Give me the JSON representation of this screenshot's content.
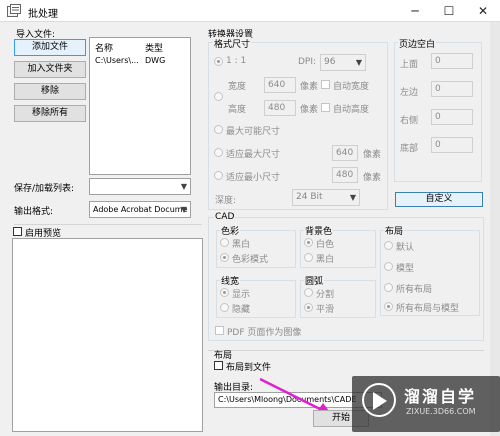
{
  "window": {
    "title": "批处理",
    "minimize": "─",
    "maximize": "☐",
    "close": "✕"
  },
  "import": {
    "label": "导入文件:",
    "buttons": {
      "add_file": "添加文件",
      "add_folder": "加入文件夹",
      "remove": "移除",
      "remove_all": "移除所有"
    },
    "columns": [
      "名称",
      "类型"
    ],
    "files": [
      {
        "name": "C:\\Users\\...",
        "type": "DWG"
      }
    ]
  },
  "save_load": {
    "label": "保存/加载列表:",
    "value": ""
  },
  "output_format": {
    "label": "输出格式:",
    "value": "Adobe Acrobat Docume"
  },
  "preview": {
    "label": "启用预览"
  },
  "converter": {
    "label": "转换器设置",
    "format_size": {
      "label": "格式尺寸",
      "ratio": "1 : 1",
      "dpi_label": "DPI:",
      "dpi_value": "96",
      "width_label": "宽度",
      "width_value": "640",
      "height_label": "高度",
      "height_value": "480",
      "pixel_unit": "像素",
      "auto_width": "自动宽度",
      "auto_height": "自动高度",
      "max_possible": "最大可能尺寸",
      "fit_max": "适应最大尺寸",
      "fit_max_value": "640",
      "fit_min": "适应最小尺寸",
      "fit_min_value": "480",
      "depth_label": "深度:",
      "depth_value": "24 Bit"
    },
    "page_margin": {
      "label": "页边空白",
      "top_label": "上面",
      "top_value": "0",
      "left_label": "左边",
      "left_value": "0",
      "right_label": "右侧",
      "right_value": "0",
      "bottom_label": "底部",
      "bottom_value": "0"
    },
    "custom_button": "自定义"
  },
  "cad": {
    "label": "CAD",
    "color": {
      "label": "色彩",
      "options": [
        "黑白",
        "色彩模式"
      ]
    },
    "background": {
      "label": "背景色",
      "options": [
        "白色",
        "黑白"
      ]
    },
    "layout": {
      "label": "布局",
      "options": [
        "默认",
        "模型",
        "所有布局",
        "所有布局与模型"
      ]
    },
    "lineweight": {
      "label": "线宽",
      "options": [
        "显示",
        "隐藏"
      ]
    },
    "arc": {
      "label": "圆弧",
      "options": [
        "分割",
        "平滑"
      ]
    },
    "pdf_page_as_image": "PDF 页面作为图像"
  },
  "layout_section": {
    "label": "布局",
    "layout_to_file": "布局到文件"
  },
  "output_dir": {
    "label": "输出目录:",
    "value": "C:\\Users\\Mloong\\Documents\\CADE"
  },
  "start_button": "开始",
  "watermark": {
    "title": "溜溜自学",
    "subtitle": "ZIXUE.3D66.COM"
  }
}
